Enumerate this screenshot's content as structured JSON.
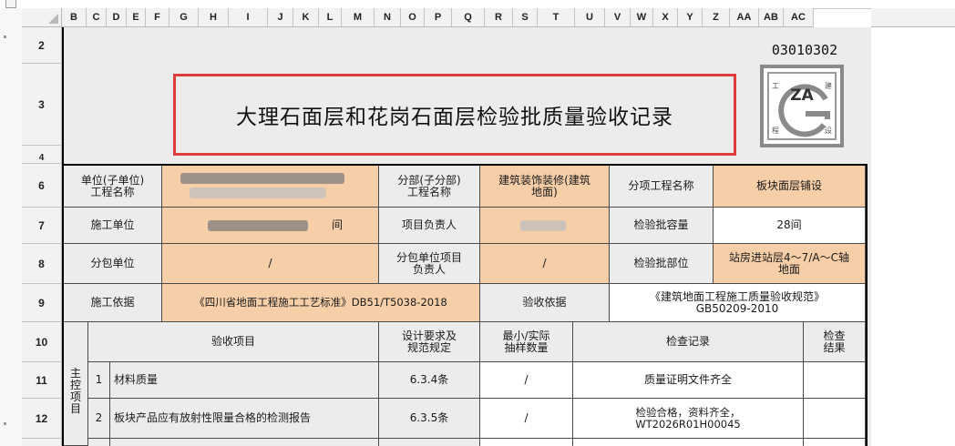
{
  "column_headers": [
    "B",
    "C",
    "D",
    "E",
    "F",
    "G",
    "H",
    "I",
    "J",
    "K",
    "L",
    "M",
    "N",
    "O",
    "P",
    "Q",
    "R",
    "S",
    "T",
    "U",
    "V",
    "W",
    "X",
    "Y",
    "Z",
    "AA",
    "AB",
    "AC"
  ],
  "row_headers": [
    "2",
    "3",
    "4",
    "6",
    "7",
    "8",
    "9",
    "10",
    "11",
    "12"
  ],
  "form": {
    "code": "03010302",
    "title": "大理石面层和花岗石面层检验批质量验收记录",
    "logo_text": "ZA",
    "logo_chars": [
      "工",
      "建",
      "程",
      "设"
    ]
  },
  "info": {
    "unit_label": "单位(子单位)\n工程名称",
    "subdiv_label": "分部(子分部)\n工程名称",
    "subdiv_value": "建筑装饰装修(建筑\n地面)",
    "subitem_label": "分项工程名称",
    "subitem_value": "板块面层铺设",
    "contractor_label": "施工单位",
    "contractor_suffix": "间",
    "pm_label": "项目负责人",
    "capacity_label": "检验批容量",
    "capacity_value": "28间",
    "subcontractor_label": "分包单位",
    "subcontractor_value": "/",
    "sub_pm_label": "分包单位项目\n负责人",
    "sub_pm_value": "/",
    "location_label": "检验批部位",
    "location_value": "站房进站层4～7/A～C轴\n地面",
    "basis_label": "施工依据",
    "basis_value": "《四川省地面工程施工工艺标准》DB51/T5038-2018",
    "acceptance_basis_label": "验收依据",
    "acceptance_basis_value": "《建筑地面工程施工质量验收规范》\nGB50209-2010"
  },
  "table": {
    "header_item": "验收项目",
    "header_design": "设计要求及\n规范规定",
    "header_sample": "最小/实际\n抽样数量",
    "header_record": "检查记录",
    "header_result": "检查\n结果",
    "main_control": "主\n控\n项\n目",
    "rows": [
      {
        "no": "1",
        "item": "材料质量",
        "clause": "6.3.4条",
        "sample": "/",
        "record": "质量证明文件齐全"
      },
      {
        "no": "2",
        "item": "板块产品应有放射性限量合格的检测报告",
        "clause": "6.3.5条",
        "sample": "/",
        "record": "检验合格，资料齐全，\nWT2026R01H00045"
      }
    ]
  },
  "colors": {
    "value_fill": "#f6cfa8",
    "label_fill": "#ececec",
    "title_border": "#e03c3c"
  }
}
